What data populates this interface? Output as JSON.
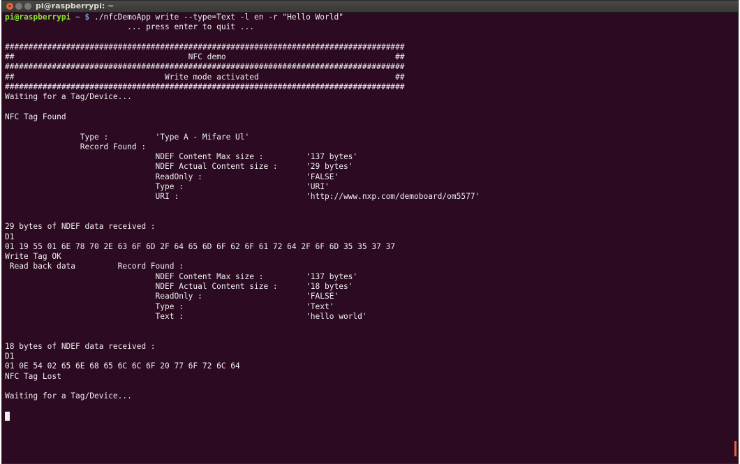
{
  "window": {
    "title": "pi@raspberrypi: ~",
    "close_glyph": "✕",
    "accent_close": "#e9643a",
    "background": "#2c0a22"
  },
  "terminal": {
    "prompt_user": "pi@raspberrypi",
    "prompt_path": " ~ $",
    "command": " ./nfcDemoApp write --type=Text -l en -r \"Hello World\"",
    "lines": [
      "                          ... press enter to quit ...",
      "",
      "#####################################################################################",
      "##                                     NFC demo                                    ##",
      "#####################################################################################",
      "##                                Write mode activated                             ##",
      "#####################################################################################",
      "Waiting for a Tag/Device...",
      "",
      "NFC Tag Found",
      "",
      "                Type :          'Type A - Mifare Ul'",
      "                Record Found :",
      "                                NDEF Content Max size :         '137 bytes'",
      "                                NDEF Actual Content size :      '29 bytes'",
      "                                ReadOnly :                      'FALSE'",
      "                                Type :                          'URI'",
      "                                URI :                           'http://www.nxp.com/demoboard/om5577'",
      "",
      "",
      "29 bytes of NDEF data received :",
      "D1",
      "01 19 55 01 6E 78 70 2E 63 6F 6D 2F 64 65 6D 6F 62 6F 61 72 64 2F 6F 6D 35 35 37 37",
      "Write Tag OK",
      " Read back data         Record Found :",
      "                                NDEF Content Max size :         '137 bytes'",
      "                                NDEF Actual Content size :      '18 bytes'",
      "                                ReadOnly :                      'FALSE'",
      "                                Type :                          'Text'",
      "                                Text :                          'hello world'",
      "",
      "",
      "18 bytes of NDEF data received :",
      "D1",
      "01 0E 54 02 65 6E 68 65 6C 6C 6F 20 77 6F 72 6C 64",
      "NFC Tag Lost",
      "",
      "Waiting for a Tag/Device...",
      ""
    ]
  }
}
